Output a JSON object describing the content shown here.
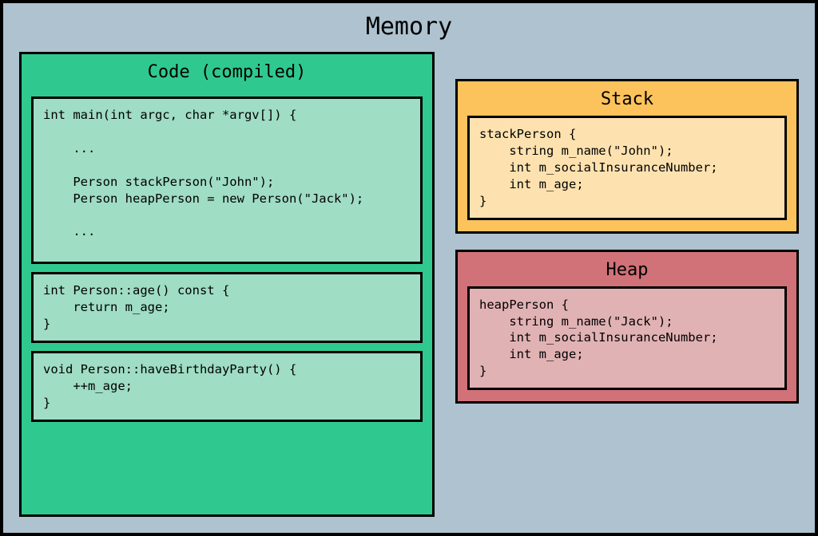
{
  "title": "Memory",
  "code": {
    "title": "Code (compiled)",
    "blocks": {
      "main": "int main(int argc, char *argv[]) {\n\n    ...\n\n    Person stackPerson(\"John\");\n    Person heapPerson = new Person(\"Jack\");\n\n    ...\n",
      "age": "int Person::age() const {\n    return m_age;\n}",
      "birthday": "void Person::haveBirthdayParty() {\n    ++m_age;\n}"
    }
  },
  "stack": {
    "title": "Stack",
    "content": "stackPerson {\n    string m_name(\"John\");\n    int m_socialInsuranceNumber;\n    int m_age;\n}"
  },
  "heap": {
    "title": "Heap",
    "content": "heapPerson {\n    string m_name(\"Jack\");\n    int m_socialInsuranceNumber;\n    int m_age;\n}"
  }
}
